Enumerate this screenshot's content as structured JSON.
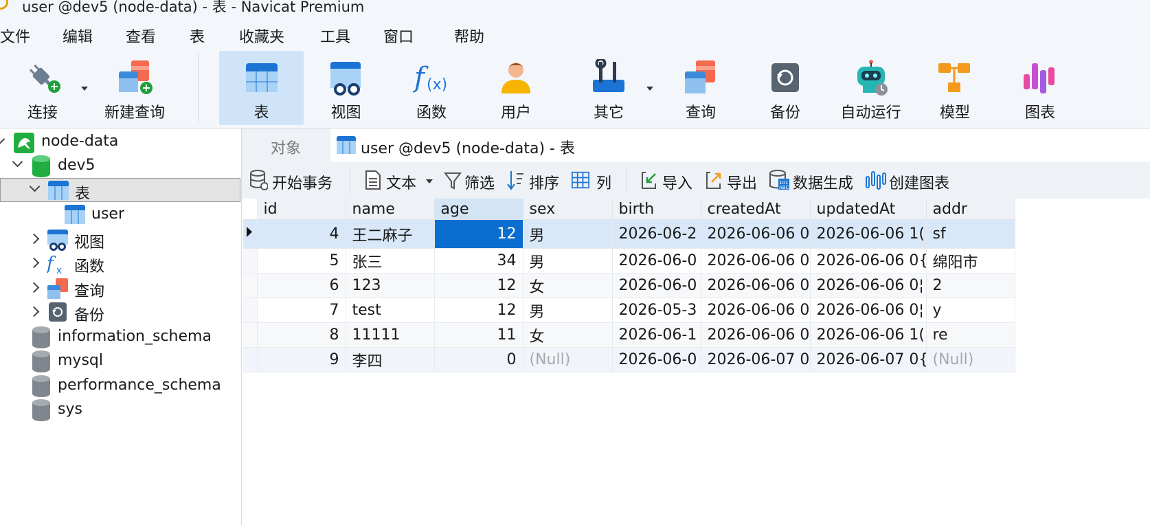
{
  "window": {
    "title": "user @dev5 (node-data) - 表 - Navicat Premium"
  },
  "menu": [
    "文件",
    "编辑",
    "查看",
    "表",
    "收藏夹",
    "工具",
    "窗口",
    "帮助"
  ],
  "toolbar": {
    "connect": "连接",
    "new_query": "新建查询",
    "table": "表",
    "view": "视图",
    "function": "函数",
    "user": "用户",
    "other": "其它",
    "query": "查询",
    "backup": "备份",
    "automation": "自动运行",
    "model": "模型",
    "chart": "图表"
  },
  "tree": {
    "connection": "node-data",
    "database": "dev5",
    "tables_folder": "表",
    "table_user": "user",
    "views_folder": "视图",
    "functions_folder": "函数",
    "queries_folder": "查询",
    "backups_folder": "备份",
    "other_dbs": [
      "information_schema",
      "mysql",
      "performance_schema",
      "sys"
    ]
  },
  "tabs": {
    "objects": "对象",
    "active": "user @dev5 (node-data) - 表"
  },
  "subtoolbar": {
    "begin_transaction": "开始事务",
    "text": "文本",
    "filter": "筛选",
    "sort": "排序",
    "columns": "列",
    "import": "导入",
    "export": "导出",
    "data_generation": "数据生成",
    "create_chart": "创建图表"
  },
  "grid": {
    "columns": [
      "id",
      "name",
      "age",
      "sex",
      "birth",
      "createdAt",
      "updatedAt",
      "addr"
    ],
    "rows": [
      [
        "4",
        "王二麻子",
        "12",
        "男",
        "2026-06-2",
        "2026-06-06 0",
        "2026-06-06 1(",
        "sf"
      ],
      [
        "5",
        "张三",
        "34",
        "男",
        "2026-06-0",
        "2026-06-06 0",
        "2026-06-06 0{",
        "绵阳市"
      ],
      [
        "6",
        "123",
        "12",
        "女",
        "2026-06-0",
        "2026-06-06 0",
        "2026-06-06 0¦",
        "2"
      ],
      [
        "7",
        "test",
        "12",
        "男",
        "2026-05-3",
        "2026-06-06 0",
        "2026-06-06 0¦",
        "y"
      ],
      [
        "8",
        "11111",
        "11",
        "女",
        "2026-06-1",
        "2026-06-06 0",
        "2026-06-06 1(",
        "re"
      ],
      [
        "9",
        "李四",
        "0",
        "(Null)",
        "2026-06-0",
        "2026-06-07 0",
        "2026-06-07 0{",
        "(Null)"
      ]
    ]
  },
  "colors": {
    "accent": "#0a6ed1",
    "selected_row": "#d8e8f8",
    "toolbar_bg": "#f3f6fb"
  }
}
